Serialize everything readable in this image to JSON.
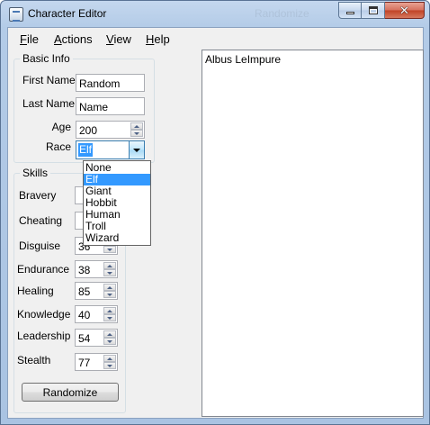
{
  "window": {
    "title": "Character Editor",
    "ghost_title": "Randomize",
    "icon": "app-form-icon"
  },
  "menu": {
    "items": [
      {
        "label_ul": "F",
        "label_rest": "ile"
      },
      {
        "label_ul": "A",
        "label_rest": "ctions"
      },
      {
        "label_ul": "V",
        "label_rest": "iew"
      },
      {
        "label_ul": "H",
        "label_rest": "elp"
      }
    ]
  },
  "basic_info": {
    "title": "Basic Info",
    "first_name_label": "First Name",
    "first_name_value": "Random",
    "last_name_label": "Last Name",
    "last_name_value": "Name",
    "age_label": "Age",
    "age_value": "200",
    "race_label": "Race",
    "race_value": "Elf"
  },
  "race_options": [
    "None",
    "Elf",
    "Giant",
    "Hobbit",
    "Human",
    "Troll",
    "Wizard"
  ],
  "race_selected_index": 1,
  "skills": {
    "title": "Skills",
    "items": [
      {
        "label": "Bravery",
        "value": ""
      },
      {
        "label": "Cheating",
        "value": ""
      },
      {
        "label": "Disguise",
        "value": "36"
      },
      {
        "label": "Endurance",
        "value": "38"
      },
      {
        "label": "Healing",
        "value": "85"
      },
      {
        "label": "Knowledge",
        "value": "40"
      },
      {
        "label": "Leadership",
        "value": "54"
      },
      {
        "label": "Stealth",
        "value": "77"
      }
    ],
    "randomize_label": "Randomize"
  },
  "output": {
    "text": "Albus LeImpure"
  },
  "colors": {
    "selection": "#3399ff",
    "close_button": "#c04225"
  }
}
